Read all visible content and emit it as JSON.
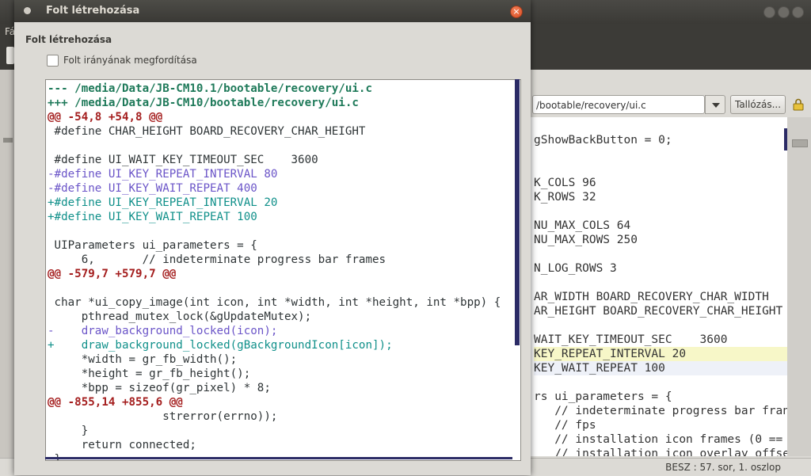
{
  "bg_window": {
    "menu_partial": "Fá",
    "path_entry_value": "/bootable/recovery/ui.c",
    "browse_button": "Tallózás...",
    "editor_lines": [
      "gShowBackButton = 0;",
      "",
      "",
      "K_COLS 96",
      "K_ROWS 32",
      "",
      "NU_MAX_COLS 64",
      "NU_MAX_ROWS 250",
      "",
      "N_LOG_ROWS 3",
      "",
      "AR_WIDTH BOARD_RECOVERY_CHAR_WIDTH",
      "AR_HEIGHT BOARD_RECOVERY_CHAR_HEIGHT",
      "",
      "WAIT_KEY_TIMEOUT_SEC    3600",
      "KEY_REPEAT_INTERVAL 20",
      "KEY_WAIT_REPEAT 100",
      "",
      "rs ui_parameters = {",
      "   // indeterminate progress bar fran",
      "   // fps",
      "   // installation icon frames (0 ==",
      "   // installation icon overlay offse"
    ],
    "status_text": "BESZ : 57. sor, 1. oszlop"
  },
  "dialog": {
    "title": "Folt létrehozása",
    "heading": "Folt létrehozása",
    "reverse_checkbox_label": "Folt irányának megfordítása",
    "reverse_checked": false,
    "diff_lines": [
      {
        "type": "file",
        "text": "--- /media/Data/JB-CM10.1/bootable/recovery/ui.c"
      },
      {
        "type": "file",
        "text": "+++ /media/Data/JB-CM10/bootable/recovery/ui.c"
      },
      {
        "type": "hunk",
        "text": "@@ -54,8 +54,8 @@"
      },
      {
        "type": "ctx",
        "text": " #define CHAR_HEIGHT BOARD_RECOVERY_CHAR_HEIGHT"
      },
      {
        "type": "ctx",
        "text": " "
      },
      {
        "type": "ctx",
        "text": " #define UI_WAIT_KEY_TIMEOUT_SEC    3600"
      },
      {
        "type": "del",
        "text": "-#define UI_KEY_REPEAT_INTERVAL 80"
      },
      {
        "type": "del",
        "text": "-#define UI_KEY_WAIT_REPEAT 400"
      },
      {
        "type": "add",
        "text": "+#define UI_KEY_REPEAT_INTERVAL 20"
      },
      {
        "type": "add",
        "text": "+#define UI_KEY_WAIT_REPEAT 100"
      },
      {
        "type": "ctx",
        "text": " "
      },
      {
        "type": "ctx",
        "text": " UIParameters ui_parameters = {"
      },
      {
        "type": "ctx",
        "text": "     6,       // indeterminate progress bar frames"
      },
      {
        "type": "hunk",
        "text": "@@ -579,7 +579,7 @@"
      },
      {
        "type": "ctx",
        "text": " "
      },
      {
        "type": "ctx",
        "text": " char *ui_copy_image(int icon, int *width, int *height, int *bpp) {"
      },
      {
        "type": "ctx",
        "text": "     pthread_mutex_lock(&gUpdateMutex);"
      },
      {
        "type": "del",
        "text": "-    draw_background_locked(icon);"
      },
      {
        "type": "add",
        "text": "+    draw_background_locked(gBackgroundIcon[icon]);"
      },
      {
        "type": "ctx",
        "text": "     *width = gr_fb_width();"
      },
      {
        "type": "ctx",
        "text": "     *height = gr_fb_height();"
      },
      {
        "type": "ctx",
        "text": "     *bpp = sizeof(gr_pixel) * 8;"
      },
      {
        "type": "hunk",
        "text": "@@ -855,14 +855,6 @@"
      },
      {
        "type": "ctx",
        "text": "                 strerror(errno));"
      },
      {
        "type": "ctx",
        "text": "     }"
      },
      {
        "type": "ctx",
        "text": "     return connected;"
      },
      {
        "type": "ctx",
        "text": " }"
      }
    ]
  },
  "colors": {
    "file_header": "#1f7a5a",
    "hunk_header": "#a41e1e",
    "removed": "#6b55c8",
    "added": "#10908a",
    "close_button": "#e05a2b"
  }
}
